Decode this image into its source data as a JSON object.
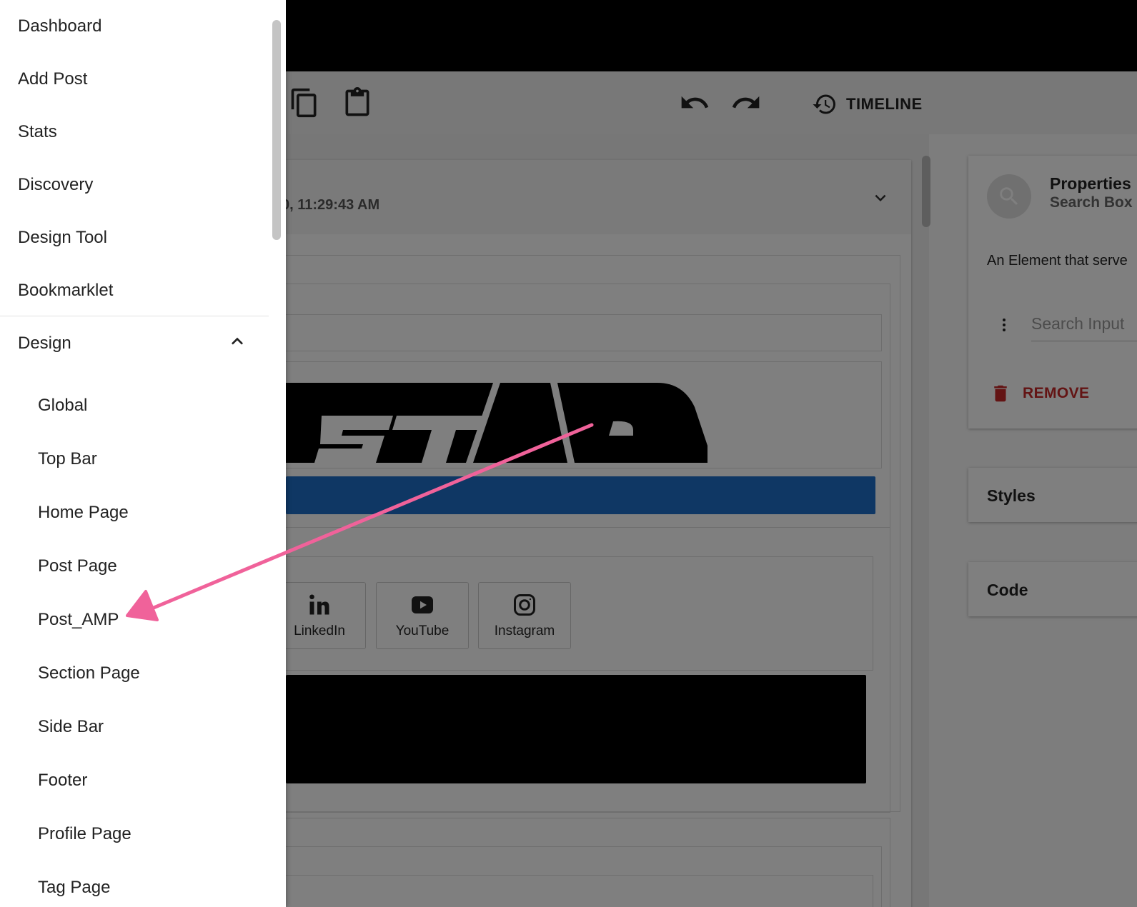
{
  "toolbar": {
    "timeline_label": "TIMELINE"
  },
  "canvas": {
    "date_fragment": "0, 11:29:43 AM"
  },
  "social": [
    {
      "label": "LinkedIn",
      "icon": "linkedin-icon"
    },
    {
      "label": "YouTube",
      "icon": "youtube-icon"
    },
    {
      "label": "Instagram",
      "icon": "instagram-icon"
    }
  ],
  "properties": {
    "title": "Properties",
    "subtitle": "Search Box",
    "description": "An Element that serve",
    "input_placeholder": "Search Input",
    "remove_label": "REMOVE",
    "styles_label": "Styles",
    "code_label": "Code"
  },
  "drawer": {
    "items": [
      "Dashboard",
      "Add Post",
      "Stats",
      "Discovery",
      "Design Tool",
      "Bookmarklet"
    ],
    "section_label": "Design",
    "sub_items": [
      "Global",
      "Top Bar",
      "Home Page",
      "Post Page",
      "Post_AMP",
      "Section Page",
      "Side Bar",
      "Footer",
      "Profile Page",
      "Tag Page"
    ]
  },
  "colors": {
    "annotation_arrow": "#f0629a",
    "remove": "#c62828",
    "blue_bar": "#1e6ec8"
  }
}
